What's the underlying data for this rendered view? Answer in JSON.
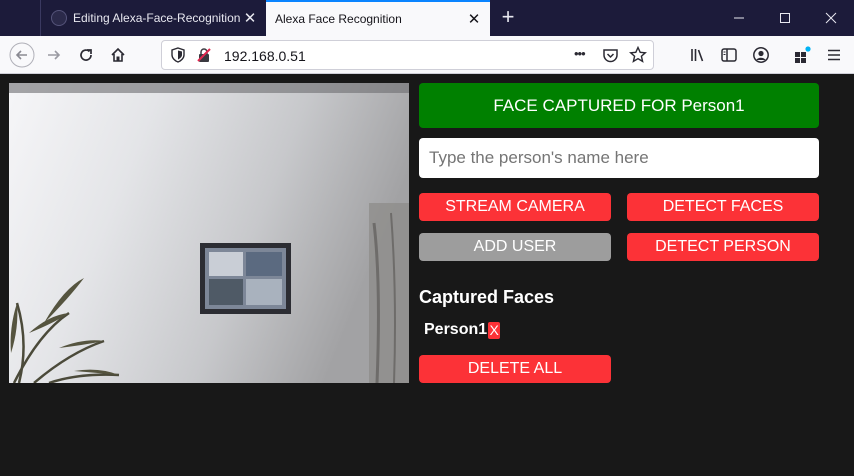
{
  "browser": {
    "tabs": [
      {
        "title": "Editing Alexa-Face-Recognition",
        "close": "✕"
      },
      {
        "title": "Alexa Face Recognition",
        "close": "✕"
      }
    ],
    "new_tab": "+",
    "url": "192.168.0.51",
    "more_actions": "•••"
  },
  "page": {
    "status_message": "FACE CAPTURED FOR Person1",
    "name_input": {
      "value": "",
      "placeholder": "Type the person's name here"
    },
    "buttons": {
      "stream_camera": "STREAM CAMERA",
      "detect_faces": "DETECT FACES",
      "add_user": "ADD USER",
      "detect_person": "DETECT PERSON",
      "delete_all": "DELETE ALL"
    },
    "captured_heading": "Captured Faces",
    "captured_faces": [
      {
        "name": "Person1",
        "delete_label": "X"
      }
    ]
  },
  "colors": {
    "page_bg": "#181818",
    "status_green": "#008000",
    "button_red": "#fc3237",
    "button_gray": "#9d9d9d",
    "tabstrip_bg": "#1c1b3a",
    "accent_blue": "#0a84ff"
  },
  "icons": [
    "back-icon",
    "forward-icon",
    "reload-icon",
    "home-icon",
    "shield-icon",
    "insecure-lock-icon",
    "more-icon",
    "pocket-icon",
    "bookmark-star-icon",
    "library-icon",
    "sidebar-icon",
    "account-icon",
    "extensions-icon",
    "menu-icon",
    "minimize-icon",
    "maximize-icon",
    "close-window-icon"
  ]
}
